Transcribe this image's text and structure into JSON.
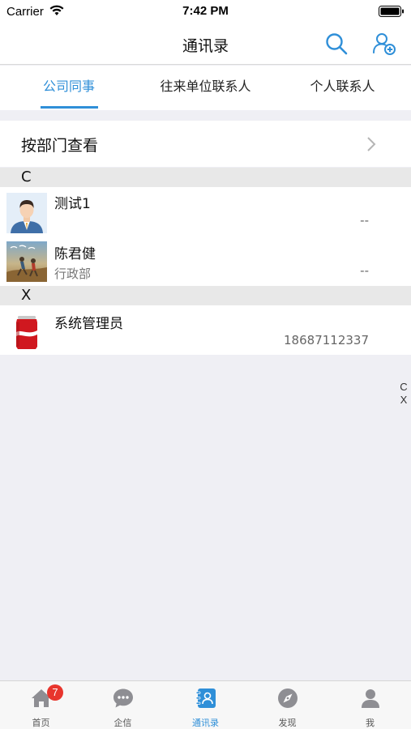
{
  "status_bar": {
    "carrier": "Carrier",
    "time": "7:42 PM"
  },
  "nav": {
    "title": "通讯录"
  },
  "tabs": [
    {
      "label": "公司同事",
      "active": true
    },
    {
      "label": "往来单位联系人",
      "active": false
    },
    {
      "label": "个人联系人",
      "active": false
    }
  ],
  "department_link": {
    "label": "按部门查看"
  },
  "sections": [
    {
      "letter": "C",
      "contacts": [
        {
          "name": "测试1",
          "dept": "",
          "phone": "--",
          "avatar": "businessman-avatar"
        },
        {
          "name": "陈君健",
          "dept": "行政部",
          "phone": "--",
          "avatar": "runners-photo-avatar"
        }
      ]
    },
    {
      "letter": "X",
      "contacts": [
        {
          "name": "系统管理员",
          "dept": "",
          "phone": "18687112337",
          "avatar": "cola-can-avatar"
        }
      ]
    }
  ],
  "index_bar": [
    "C",
    "X"
  ],
  "tabbar": {
    "items": [
      {
        "label": "首页",
        "icon": "home-icon",
        "badge": "7",
        "active": false
      },
      {
        "label": "企信",
        "icon": "chat-icon",
        "badge": "",
        "active": false
      },
      {
        "label": "通讯录",
        "icon": "contacts-icon",
        "badge": "",
        "active": true
      },
      {
        "label": "发现",
        "icon": "compass-icon",
        "badge": "",
        "active": false
      },
      {
        "label": "我",
        "icon": "person-icon",
        "badge": "",
        "active": false
      }
    ]
  },
  "colors": {
    "accent": "#2f8fd8",
    "badge": "#e8352d",
    "background": "#efeff4"
  }
}
